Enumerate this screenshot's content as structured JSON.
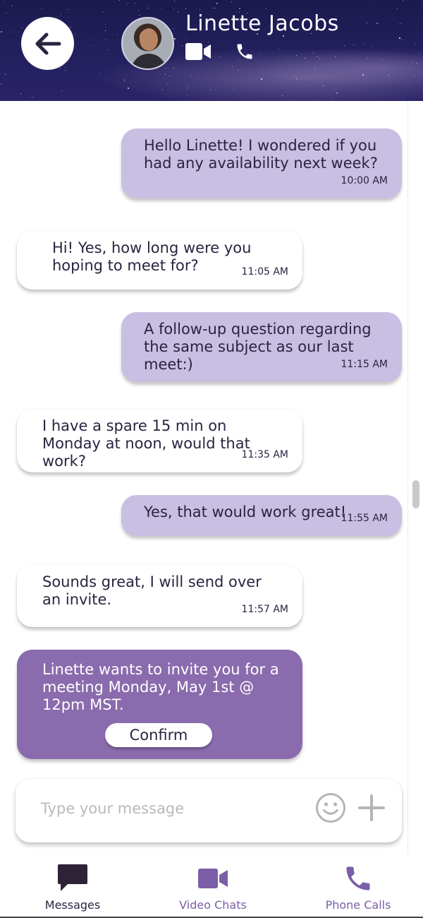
{
  "header": {
    "contact_name": "Linette Jacobs",
    "back_icon": "arrow-left-icon",
    "video_icon": "video-camera-icon",
    "phone_icon": "phone-icon"
  },
  "messages": [
    {
      "direction": "outgoing",
      "text": "Hello Linette! I wondered if you had any availability next week?",
      "time": "10:00 AM"
    },
    {
      "direction": "incoming",
      "text": "Hi! Yes, how long were you hoping to meet for?",
      "time": "11:05 AM"
    },
    {
      "direction": "outgoing",
      "text": "A follow-up question regarding the same subject as our last meet:)",
      "time": "11:15 AM"
    },
    {
      "direction": "incoming",
      "text": "I have a spare 15 min on Monday at noon, would that work?",
      "time": "11:35 AM"
    },
    {
      "direction": "outgoing",
      "text": "Yes, that would work great!",
      "time": "11:55 AM"
    },
    {
      "direction": "incoming",
      "text": "Sounds great, I will send over an invite.",
      "time": "11:57 AM"
    }
  ],
  "invite": {
    "text": "Linette wants to invite you for a meeting Monday, May 1st @ 12pm MST.",
    "confirm_label": "Confirm"
  },
  "composer": {
    "placeholder": "Type your message",
    "emoji_icon": "smiley-icon",
    "add_icon": "plus-icon"
  },
  "tabs": [
    {
      "label": "Messages",
      "icon": "chat-bubble-icon",
      "active": true
    },
    {
      "label": "Video Chats",
      "icon": "video-camera-icon",
      "active": false
    },
    {
      "label": "Phone Calls",
      "icon": "phone-icon",
      "active": false
    }
  ],
  "colors": {
    "outgoing_bubble": "#c8bfe2",
    "incoming_bubble": "#ffffff",
    "invite_bubble": "#8a6bad",
    "accent": "#7b5ea7",
    "active_tab": "#2a2440"
  }
}
